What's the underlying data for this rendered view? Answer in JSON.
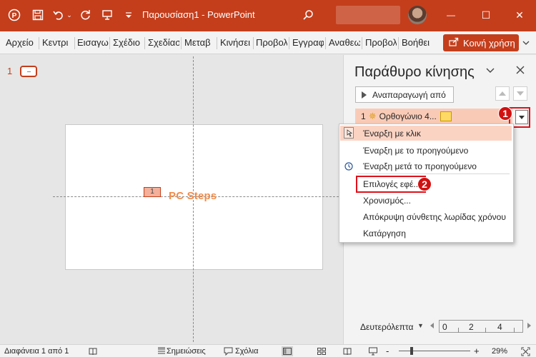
{
  "window": {
    "title": "Παρουσίαση1 - PowerPoint",
    "minimize_glyph": "—",
    "maximize_glyph": "☐",
    "close_glyph": "✕"
  },
  "ribbon": {
    "tabs": [
      "Αρχείο",
      "Κεντρι",
      "Εισαγω",
      "Σχέδιο",
      "Σχεδίασ",
      "Μεταβ",
      "Κινήσει",
      "Προβολ",
      "Εγγραφ",
      "Αναθεω",
      "Προβολ",
      "Βοήθει"
    ],
    "share_label": "Κοινή χρήση"
  },
  "thumbnails": {
    "slide_number": "1"
  },
  "slide": {
    "animation_tag": "1",
    "text": "PC Steps"
  },
  "animation_pane": {
    "title": "Παράθυρο κίνησης",
    "play_label": "Αναπαραγωγή από",
    "item": {
      "number": "1",
      "name": "Ορθογώνιο 4..."
    },
    "badge_1": "1",
    "badge_2": "2",
    "timeline_label": "Δευτερόλεπτα",
    "timeline_ticks": [
      "0",
      "2",
      "4"
    ]
  },
  "context_menu": {
    "items": [
      "Έναρξη με κλικ",
      "Έναρξη με το προηγούμενο",
      "Έναρξη μετά το προηγούμενο",
      "Επιλογές εφέ...",
      "Χρονισμός...",
      "Απόκρυψη σύνθετης λωρίδας χρόνου",
      "Κατάργηση"
    ]
  },
  "status_bar": {
    "slide_info": "Διαφάνεια 1 από 1",
    "notes_label": "Σημειώσεις",
    "comments_label": "Σχόλια",
    "zoom_level": "29%",
    "zoom_minus": "-",
    "zoom_plus": "+"
  },
  "colors": {
    "accent": "#c43e1c",
    "highlight": "#e0101a",
    "selection": "#fbd3c3"
  }
}
